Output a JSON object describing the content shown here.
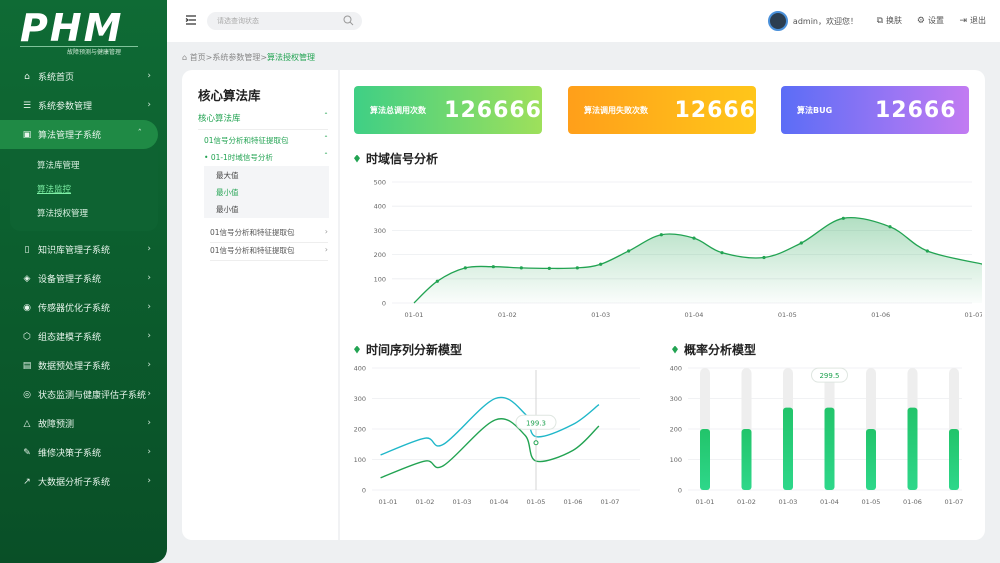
{
  "app": {
    "logo_text": "PHM",
    "logo_sub": "故障预测与健康管理"
  },
  "sidebar": {
    "items_top": [
      {
        "label": "系统首页",
        "icon": "home-icon"
      },
      {
        "label": "系统参数管理",
        "icon": "sliders-icon"
      },
      {
        "label": "算法管理子系统",
        "icon": "algorithm-icon"
      }
    ],
    "sub_items": [
      {
        "label": "算法库管理"
      },
      {
        "label": "算法监控"
      },
      {
        "label": "算法授权管理"
      }
    ],
    "items_bottom": [
      {
        "label": "知识库管理子系统",
        "icon": "book-icon"
      },
      {
        "label": "设备管理子系统",
        "icon": "device-icon"
      },
      {
        "label": "传感器优化子系统",
        "icon": "sensor-icon"
      },
      {
        "label": "组态建模子系统",
        "icon": "model-icon"
      },
      {
        "label": "数据预处理子系统",
        "icon": "database-icon"
      },
      {
        "label": "状态监测与健康评估子系统",
        "icon": "monitor-icon"
      },
      {
        "label": "故障预测",
        "icon": "warning-icon"
      },
      {
        "label": "维修决策子系统",
        "icon": "wrench-icon"
      },
      {
        "label": "大数据分析子系统",
        "icon": "chart-icon"
      }
    ]
  },
  "topbar": {
    "search_placeholder": "请选查询状态",
    "user_text": "admin，欢迎您！",
    "skin_label": "换肤",
    "settings_label": "设置",
    "logout_label": "退出"
  },
  "breadcrumb": {
    "parts": "首页>系统参数管理>",
    "last": "算法授权管理"
  },
  "tree": {
    "title": "核心算法库",
    "root": "核心算法库",
    "node1": "01信号分析和特征提取包",
    "node2": "01-1时域信号分析",
    "leaves": [
      "最大值",
      "最小值",
      "最小值"
    ],
    "node3": "01信号分析和特征提取包",
    "node4": "01信号分析和特征提取包"
  },
  "kpis": [
    {
      "label": "算法总调用次数",
      "value": "126666"
    },
    {
      "label": "算法调用失败次数",
      "value": "12666"
    },
    {
      "label": "算法BUG",
      "value": "12666"
    }
  ],
  "sections": {
    "time_domain": "时域信号分析",
    "series_model": "时间序列分新模型",
    "prob_model": "概率分析模型"
  },
  "chart_data": [
    {
      "type": "area",
      "title": "时域信号分析",
      "x": [
        "01-01",
        "01-02",
        "01-03",
        "01-04",
        "01-05",
        "01-06",
        "01-07"
      ],
      "ylim": [
        0,
        500
      ],
      "yticks": [
        0,
        100,
        200,
        300,
        400,
        500
      ],
      "points": [
        [
          0,
          0
        ],
        [
          0.25,
          90
        ],
        [
          0.55,
          145
        ],
        [
          0.85,
          150
        ],
        [
          1.15,
          145
        ],
        [
          1.45,
          143
        ],
        [
          1.75,
          145
        ],
        [
          2.0,
          160
        ],
        [
          2.3,
          215
        ],
        [
          2.65,
          282
        ],
        [
          3.0,
          268
        ],
        [
          3.3,
          208
        ],
        [
          3.75,
          188
        ],
        [
          4.15,
          248
        ],
        [
          4.6,
          350
        ],
        [
          5.1,
          315
        ],
        [
          5.5,
          215
        ],
        [
          6.1,
          160
        ]
      ]
    },
    {
      "type": "line",
      "title": "时间序列分新模型",
      "x": [
        "01-01",
        "01-02",
        "01-03",
        "01-04",
        "01-05",
        "01-06",
        "01-07"
      ],
      "ylim": [
        0,
        400
      ],
      "yticks": [
        0,
        100,
        200,
        300,
        400
      ],
      "series": [
        {
          "values": [
            [
              -0.2,
              115
            ],
            [
              1.0,
              170
            ],
            [
              1.5,
              150
            ],
            [
              2.9,
              300
            ],
            [
              3.7,
              250
            ],
            [
              4.0,
              175
            ],
            [
              5.0,
              215
            ],
            [
              5.7,
              280
            ]
          ]
        },
        {
          "values": [
            [
              -0.2,
              40
            ],
            [
              1.0,
              95
            ],
            [
              1.5,
              80
            ],
            [
              2.9,
              230
            ],
            [
              3.7,
              180
            ],
            [
              4.0,
              95
            ],
            [
              5.0,
              130
            ],
            [
              5.7,
              210
            ]
          ]
        }
      ],
      "tooltip": {
        "x": 4.0,
        "label": "199.3"
      }
    },
    {
      "type": "bar",
      "title": "概率分析模型",
      "categories": [
        "01-01",
        "01-02",
        "01-03",
        "01-04",
        "01-05",
        "01-06",
        "01-07"
      ],
      "values": [
        200,
        200,
        270,
        270,
        200,
        270,
        200
      ],
      "background_values": [
        400,
        400,
        400,
        400,
        400,
        400,
        400
      ],
      "ylim": [
        0,
        400
      ],
      "yticks": [
        0,
        100,
        200,
        300,
        400
      ],
      "tooltip": {
        "index": 3,
        "label": "299.5"
      }
    }
  ],
  "colors": {
    "green": "#22a352",
    "cyan": "#1fb7c9",
    "kpi1": [
      "#3fcf85",
      "#9ee05b"
    ],
    "kpi2": [
      "#ff9f1a",
      "#ffc61a"
    ],
    "kpi3": [
      "#5b6df6",
      "#c27bf2"
    ]
  }
}
